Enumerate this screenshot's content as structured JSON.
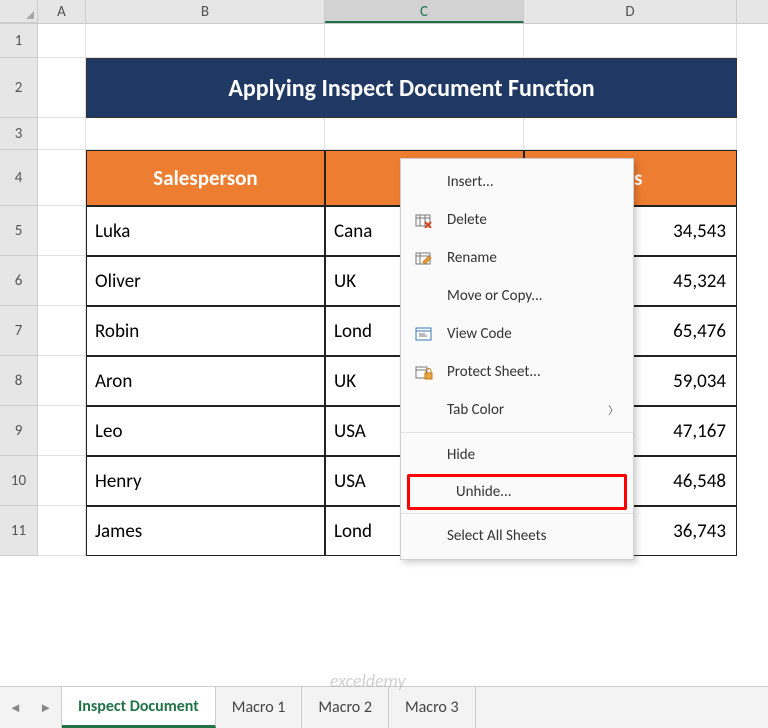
{
  "columns": [
    "A",
    "B",
    "C",
    "D"
  ],
  "selected_column": "C",
  "row_numbers": [
    1,
    2,
    3,
    4,
    5,
    6,
    7,
    8,
    9,
    10,
    11
  ],
  "title": "Applying Inspect Document Function",
  "headers": {
    "b": "Salesperson",
    "c": "",
    "d": "les"
  },
  "rows": [
    {
      "b": "Luka",
      "c": "Cana",
      "d": "34,543"
    },
    {
      "b": "Oliver",
      "c": "UK",
      "d": "45,324"
    },
    {
      "b": "Robin",
      "c": "Lond",
      "d": "65,476"
    },
    {
      "b": "Aron",
      "c": "UK",
      "d": "59,034"
    },
    {
      "b": "Leo",
      "c": "USA",
      "d": "47,167"
    },
    {
      "b": "Henry",
      "c": "USA",
      "d": "46,548"
    },
    {
      "b": "James",
      "c": "Lond",
      "d": "36,743"
    }
  ],
  "menu": {
    "insert": "Insert...",
    "delete": "Delete",
    "rename": "Rename",
    "move": "Move or Copy...",
    "view_code": "View Code",
    "protect": "Protect Sheet...",
    "tab_color": "Tab Color",
    "hide": "Hide",
    "unhide": "Unhide...",
    "select_all": "Select All Sheets"
  },
  "tabs": {
    "active": "Inspect Document",
    "others": [
      "Macro 1",
      "Macro 2",
      "Macro 3"
    ]
  },
  "watermark": "exceldemy"
}
